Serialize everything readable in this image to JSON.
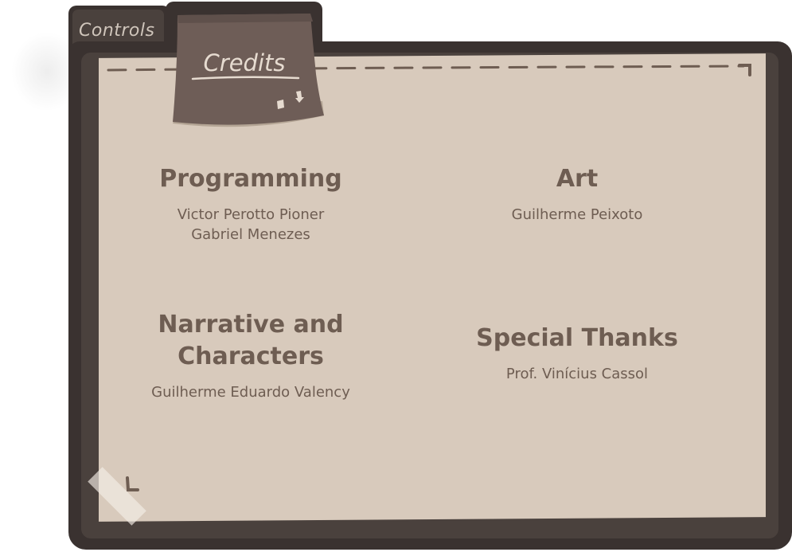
{
  "tabs": {
    "controls_label": "Controls",
    "credits_label": "Credits"
  },
  "credits": {
    "programming": {
      "title": "Programming",
      "names": [
        "Victor Perotto Pioner",
        "Gabriel Menezes"
      ]
    },
    "art": {
      "title": "Art",
      "names": [
        "Guilherme Peixoto"
      ]
    },
    "narrative": {
      "title_line1": "Narrative and",
      "title_line2": "Characters",
      "names": [
        "Guilherme Eduardo Valency"
      ]
    },
    "special_thanks": {
      "title": "Special Thanks",
      "names": [
        "Prof. Vinícius Cassol"
      ]
    }
  },
  "colors": {
    "folder_dark": "#3a3230",
    "folder_mid": "#4a413d",
    "paper": "#d8cabc",
    "sticky": "#6e5d57",
    "heading": "#6e5d52",
    "tab_text": "#cfc5bb"
  },
  "icons": {
    "sticky_icon": "bird-icon"
  }
}
